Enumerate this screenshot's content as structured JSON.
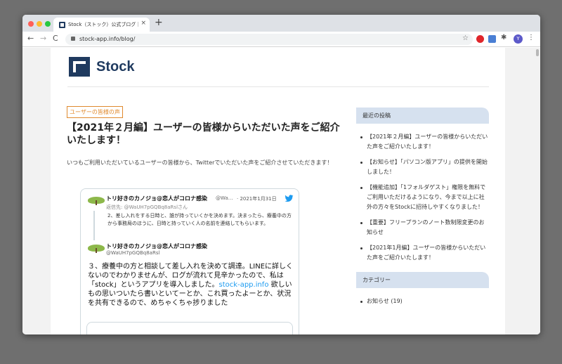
{
  "browser": {
    "tab_title": "Stock（ストック）公式ブログ｜チ",
    "tab_close": "×",
    "new_tab": "+",
    "url": "stock-app.info/blog/",
    "nav_back": "←",
    "nav_forward": "→",
    "nav_reload": "C",
    "bookmark_star": "☆",
    "avatar_letter": "Y",
    "menu_dots": "⋮",
    "extension_puzzle": "✱"
  },
  "site": {
    "logo_text": "Stock",
    "brand_color": "#1f3a5f"
  },
  "post": {
    "category": "ユーザーの皆様の声",
    "title": "【2021年２月編】ユーザーの皆様からいただいた声をご紹介いたします！",
    "intro": "いつもご利用いただいているユーザーの皆様から、Twitterでいただいた声をご紹介させていただきます！"
  },
  "tweet": {
    "author_name": "トリ好きのカノジョ@恋人がコロナ感染",
    "author_handle_short": "@Wa...",
    "date": "· 2021年1月31日",
    "reply_to": "返信先: @WaUH7pGQBq8aRslさん",
    "quoted_text": "2、差し入れをする日時と、誰が持っていくかを決めます。決まったら、療養中の方から事務局のほうに、日時と持っていく人の名前を連絡してもらいます。",
    "author_name_2": "トリ好きのカノジョ@恋人がコロナ感染",
    "author_handle": "@WaUH7pGQBq8aRsl",
    "text_before_link": "３、療養中の方と相談して差し入れを決めて調達。LINEに詳しくないのでわかりませんが、ログが流れて見辛かったので、私は「stock」というアプリを導入しました。",
    "link": "stock-app.info",
    "text_after_link": " 欲しいもの思いついたら書いといてーとか、これ買ったよーとか、状況を共有できるので、めちゃくちゃ捗りました"
  },
  "sidebar": {
    "recent_heading": "最近の投稿",
    "recent_posts": [
      "【2021年２月編】ユーザーの皆様からいただいた声をご紹介いたします！",
      "【お知らせ】「パソコン版アプリ」の提供を開始しました！",
      "【機能追加】「1フォルダゲスト」権限を無料でご利用いただけるようになり、今まで以上に社外の方々をStockに招待しやすくなりました！",
      "【重要】フリープランのノート数制限変更のお知らせ",
      "【2021年1月編】ユーザーの皆様からいただいた声をご紹介いたします！"
    ],
    "category_heading": "カテゴリー",
    "categories": [
      "お知らせ (19)"
    ]
  }
}
